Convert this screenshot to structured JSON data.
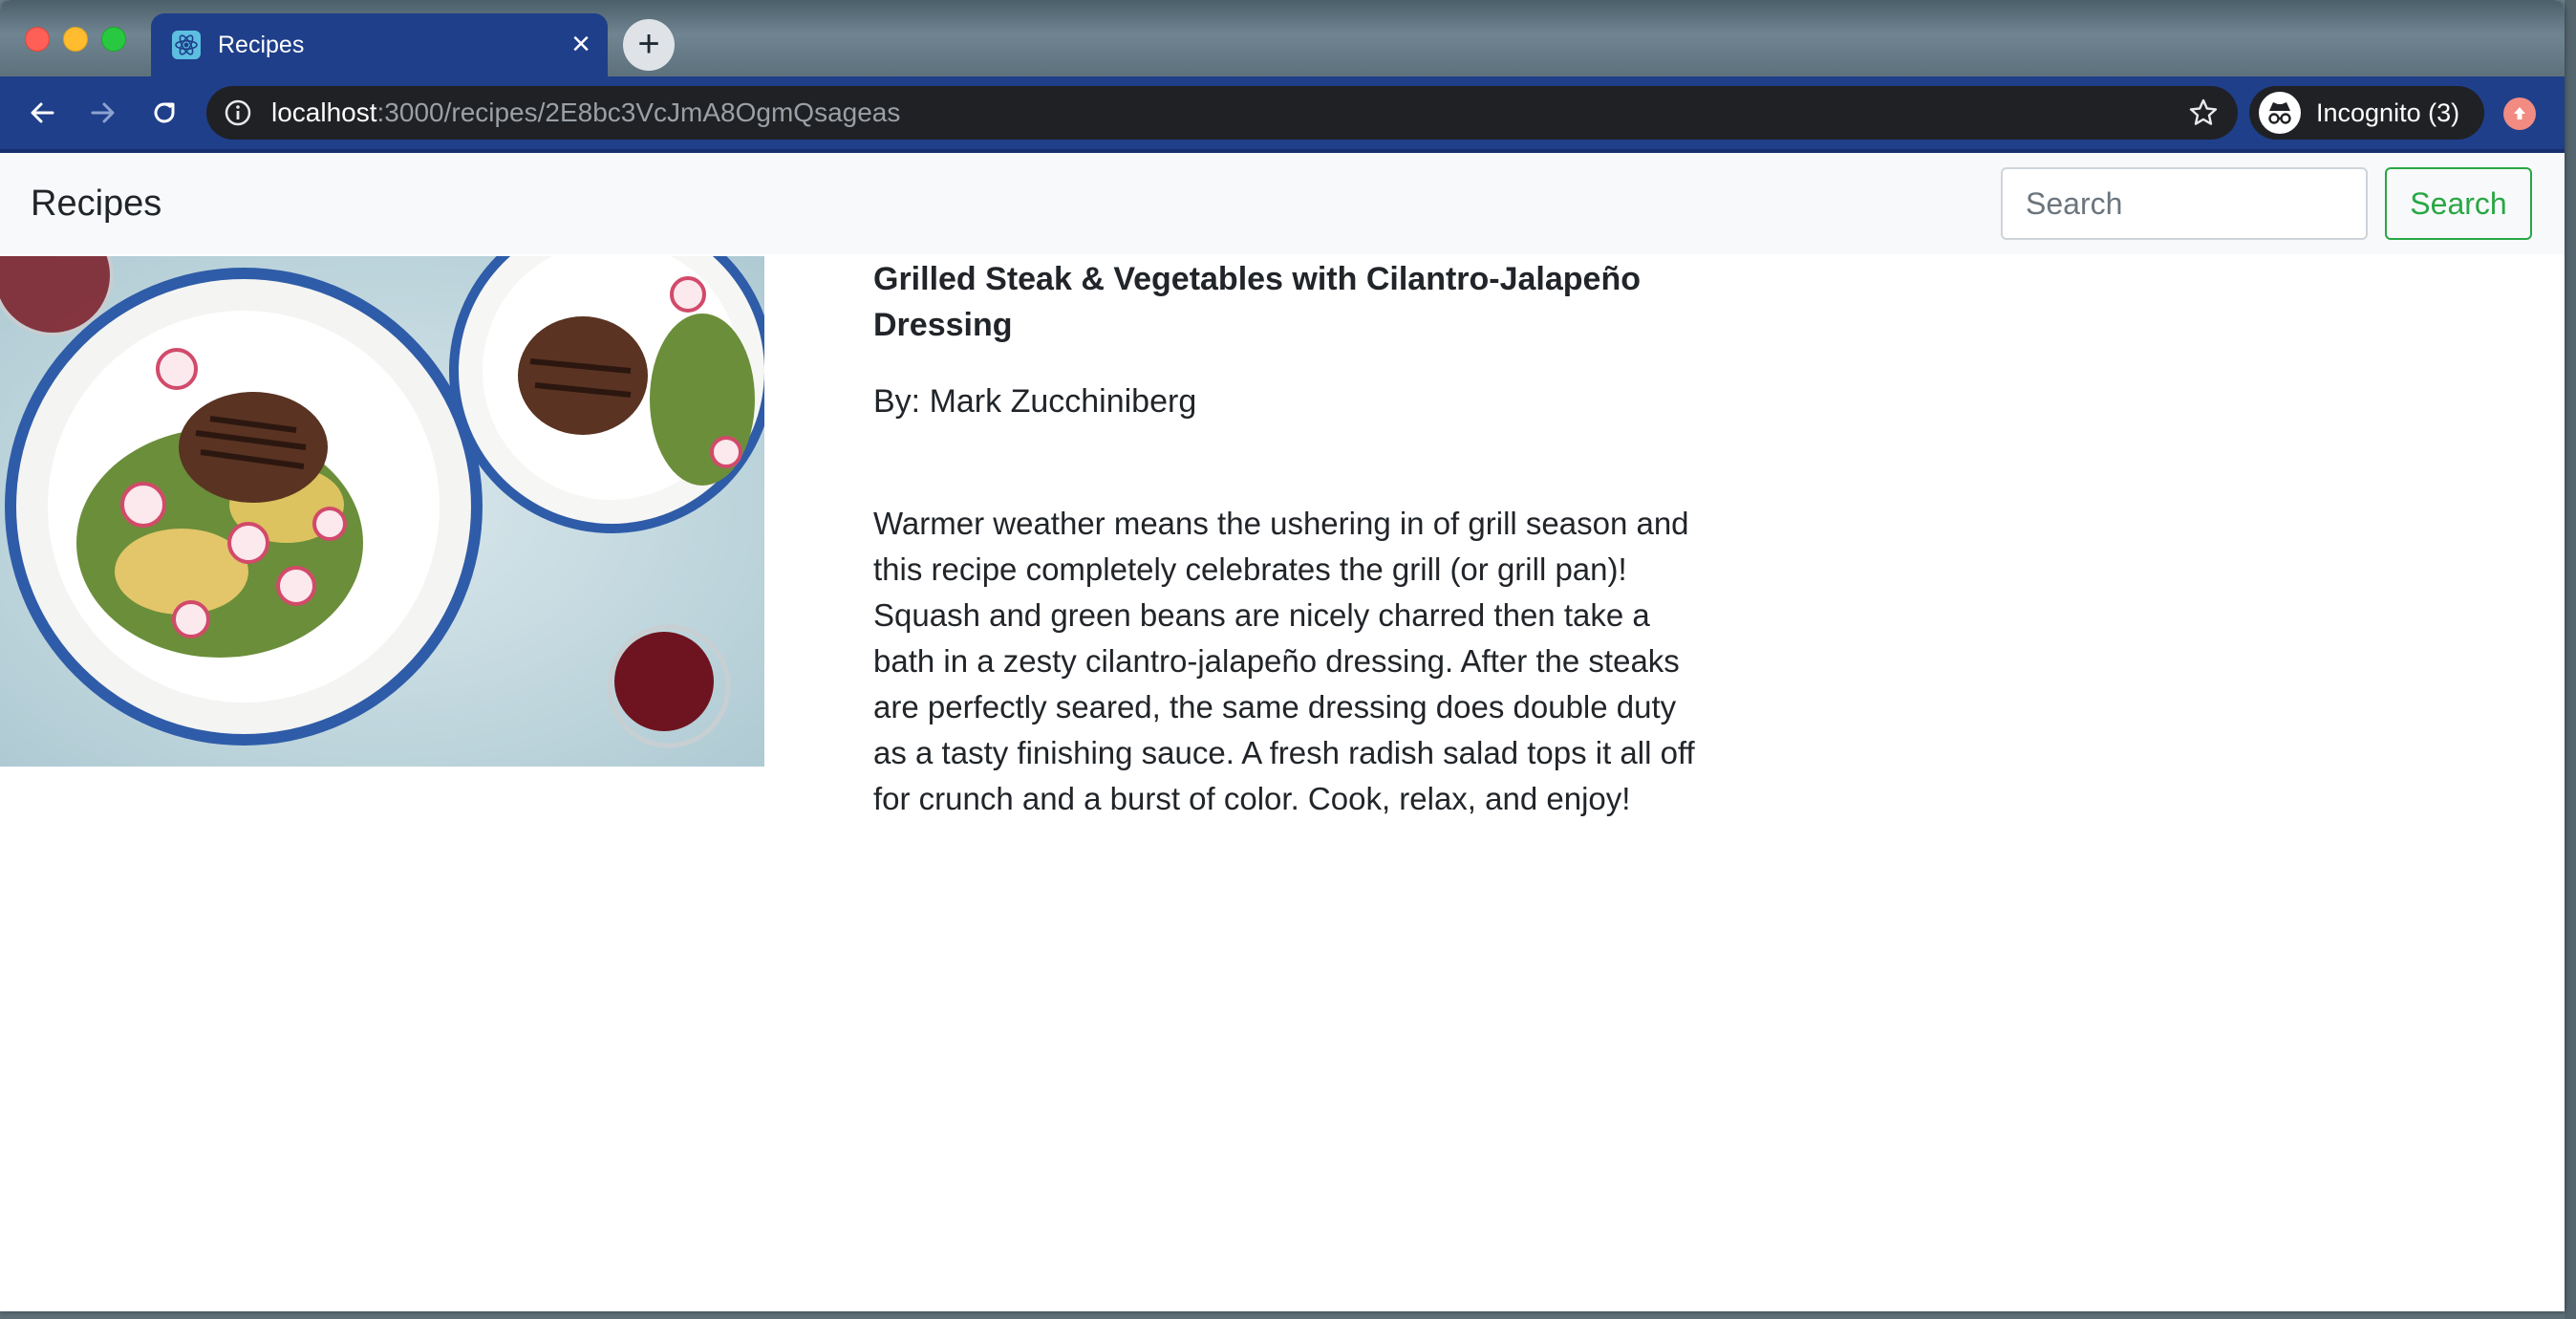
{
  "browser": {
    "tab": {
      "title": "Recipes",
      "close_glyph": "×",
      "favicon": "react-icon"
    },
    "new_tab_glyph": "+",
    "address_bar": {
      "host": "localhost",
      "path": ":3000/recipes/2E8bc3VcJmA8OgmQsageas"
    },
    "profile": {
      "label": "Incognito (3)"
    }
  },
  "navbar": {
    "brand": "Recipes",
    "search": {
      "placeholder": "Search",
      "button_label": "Search"
    }
  },
  "recipe": {
    "title": "Grilled Steak & Vegetables with Cilantro-Jalapeño Dressing",
    "author": "By: Mark Zucchiniberg",
    "description": "Warmer weather means the ushering in of grill season and this recipe completely celebrates the grill (or grill pan)! Squash and green beans are nicely charred then take a bath in a zesty cilantro-jalapeño dressing. After the steaks are perfectly seared, the same dressing does double duty as a tasty finishing sauce. A fresh radish salad tops it all off for crunch and a burst of color. Cook, relax, and enjoy!"
  },
  "colors": {
    "browser_frame": "#1f3f8a",
    "omnibox": "#202124",
    "navbar_bg": "#f8f9fa",
    "search_button": "#28a745",
    "text": "#212529"
  }
}
